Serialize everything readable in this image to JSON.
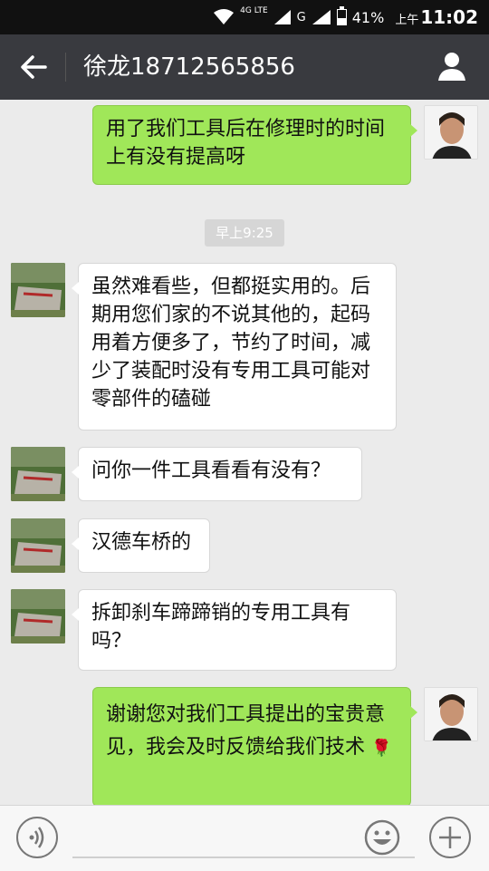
{
  "status_bar": {
    "network": "4G LTE",
    "network2": "G",
    "battery_percent": "41%",
    "battery_level": 0.41,
    "ampm": "上午",
    "time": "11:02"
  },
  "header": {
    "title": "徐龙18712565856",
    "back_icon": "back-arrow-icon",
    "profile_icon": "person-icon"
  },
  "messages": [
    {
      "side": "right",
      "text": "用了我们工具后在修理时的时间上有没有提高呀"
    },
    {
      "side": "left",
      "text": "虽然难看些，但都挺实用的。后期用您们家的不说其他的，起码用着方便多了，节约了时间，减少了装配时没有专用工具可能对零部件的磕碰"
    },
    {
      "side": "left",
      "text": "问你一件工具看看有没有？"
    },
    {
      "side": "left",
      "text": "汉德车桥的"
    },
    {
      "side": "left",
      "text": "拆卸刹车蹄蹄销的专用工具有吗？"
    },
    {
      "side": "right",
      "text": "谢谢您对我们工具提出的宝贵意见，我会及时反馈给我们技术",
      "emoji": "🌹"
    }
  ],
  "timestamp": "早上9:25",
  "bottom_bar": {
    "voice_icon": "voice-icon",
    "emoji_icon": "emoji-icon",
    "plus_icon": "plus-icon"
  },
  "colors": {
    "title_bar": "#393a3f",
    "bubble_sent": "#a0e759",
    "bubble_received": "#ffffff",
    "background": "#ebebeb"
  }
}
